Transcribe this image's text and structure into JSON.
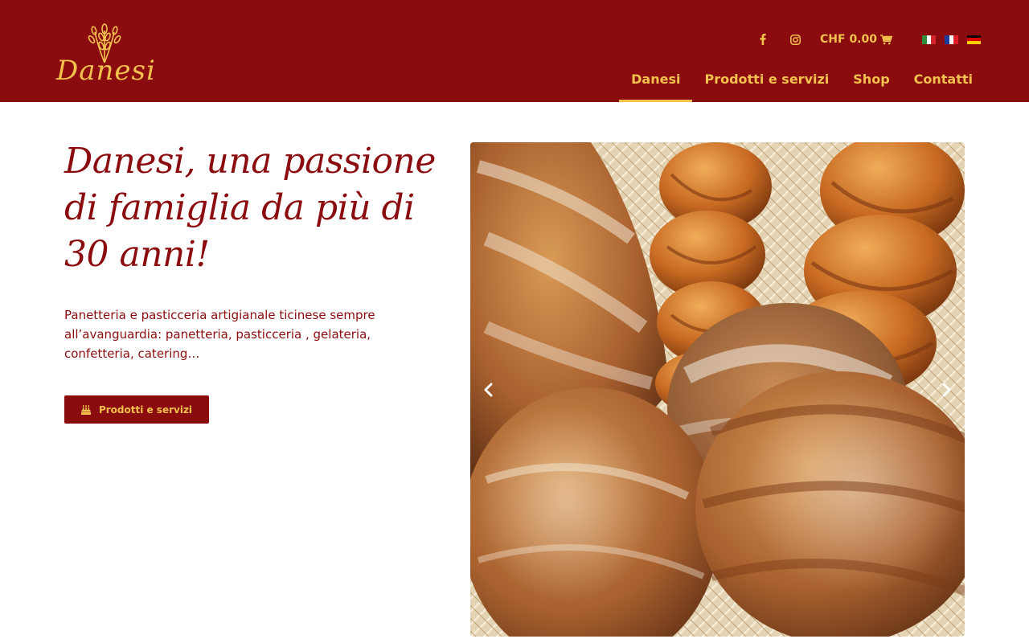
{
  "brand": {
    "logo_text": "Danesi",
    "primary_color": "#8b0c0e",
    "accent_color": "#f2c14e"
  },
  "topbar": {
    "social": [
      {
        "name": "facebook",
        "icon": "facebook-icon"
      },
      {
        "name": "instagram",
        "icon": "instagram-icon"
      }
    ],
    "cart_label": "CHF 0.00",
    "cart_icon": "shopping-cart-icon",
    "languages": [
      {
        "code": "it",
        "flag": "italy-flag"
      },
      {
        "code": "fr",
        "flag": "france-flag"
      },
      {
        "code": "de",
        "flag": "germany-flag"
      }
    ]
  },
  "nav": {
    "items": [
      {
        "label": "Danesi",
        "active": true
      },
      {
        "label": "Prodotti e servizi",
        "active": false
      },
      {
        "label": "Shop",
        "active": false
      },
      {
        "label": "Contatti",
        "active": false
      }
    ]
  },
  "hero": {
    "title": "Danesi, una passione di famiglia da più di 30 anni!",
    "description": "Panetteria e pasticceria artigianale ticinese sempre all’avanguardia: panetteria, pasticceria , gelateria, confetteria, catering…",
    "button_label": "Prodotti e servizi",
    "button_icon": "cake-icon"
  },
  "carousel": {
    "prev_icon": "chevron-left-icon",
    "next_icon": "chevron-right-icon"
  }
}
